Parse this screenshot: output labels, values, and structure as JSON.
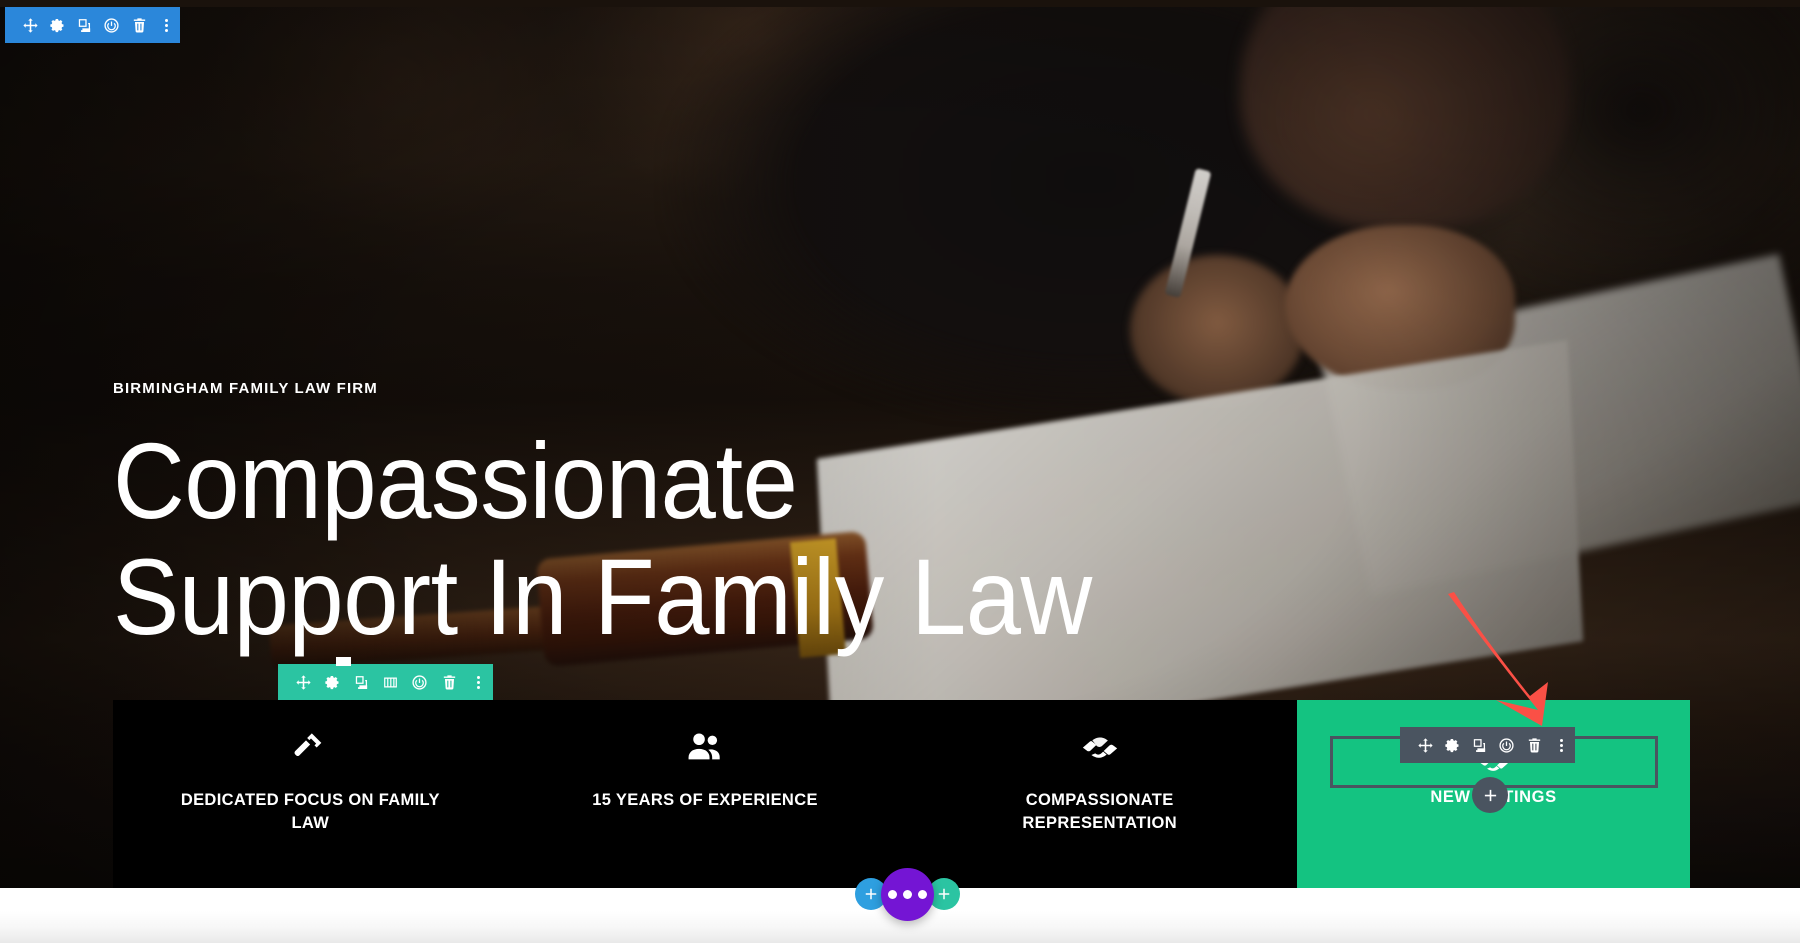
{
  "builder": {
    "section_toolbar": {
      "name": "section-toolbar",
      "color": "#2b87da",
      "buttons": [
        {
          "name": "move-icon",
          "label": "Move Section"
        },
        {
          "name": "gear-icon",
          "label": "Section Settings"
        },
        {
          "name": "duplicate-icon",
          "label": "Duplicate Section"
        },
        {
          "name": "power-icon",
          "label": "Disable Section"
        },
        {
          "name": "trash-icon",
          "label": "Delete Section"
        },
        {
          "name": "more-options-icon",
          "label": "Other Options"
        }
      ]
    },
    "row_toolbar": {
      "name": "row-toolbar",
      "color": "#2bc4a2",
      "buttons": [
        {
          "name": "move-icon",
          "label": "Move Row"
        },
        {
          "name": "gear-icon",
          "label": "Row Settings"
        },
        {
          "name": "duplicate-icon",
          "label": "Duplicate Row"
        },
        {
          "name": "columns-icon",
          "label": "Change Column Structure"
        },
        {
          "name": "power-icon",
          "label": "Disable Row"
        },
        {
          "name": "trash-icon",
          "label": "Delete Row"
        },
        {
          "name": "more-options-icon",
          "label": "Other Options"
        }
      ]
    },
    "module_toolbar": {
      "name": "module-toolbar",
      "color": "#4a5460",
      "buttons": [
        {
          "name": "move-icon",
          "label": "Move Module"
        },
        {
          "name": "gear-icon",
          "label": "Module Settings"
        },
        {
          "name": "duplicate-icon",
          "label": "Duplicate Module"
        },
        {
          "name": "power-icon",
          "label": "Disable Module"
        },
        {
          "name": "trash-icon",
          "label": "Delete Module"
        },
        {
          "name": "more-options-icon",
          "label": "Other Options"
        }
      ]
    },
    "add_module_button": {
      "name": "add-module-button",
      "label": "+"
    },
    "fab_bar": {
      "add_section_label": "+",
      "menu_label": "•••",
      "add_row_label": "+",
      "colors": {
        "add_section": "#2e9fe0",
        "menu": "#7415d4",
        "add_row": "#2bc4a2"
      }
    },
    "annotation": {
      "name": "red-arrow-annotation",
      "color": "#fa5046",
      "points_to": "trash-icon"
    }
  },
  "hero": {
    "eyebrow": "BIRMINGHAM FAMILY LAW FIRM",
    "title": "Compassionate\nSupport In Family Law"
  },
  "feature_bar": {
    "background": "#000000",
    "items": [
      {
        "icon": "gavel-icon",
        "label": "DEDICATED FOCUS ON FAMILY LAW"
      },
      {
        "icon": "people-icon",
        "label": "15 YEARS OF EXPERIENCE"
      },
      {
        "icon": "handshake-icon",
        "label": "COMPASSIONATE REPRESENTATION"
      }
    ]
  },
  "green_panel": {
    "background": "#14c381",
    "icon": "handshake-icon",
    "label": "NEW LISTINGS"
  }
}
